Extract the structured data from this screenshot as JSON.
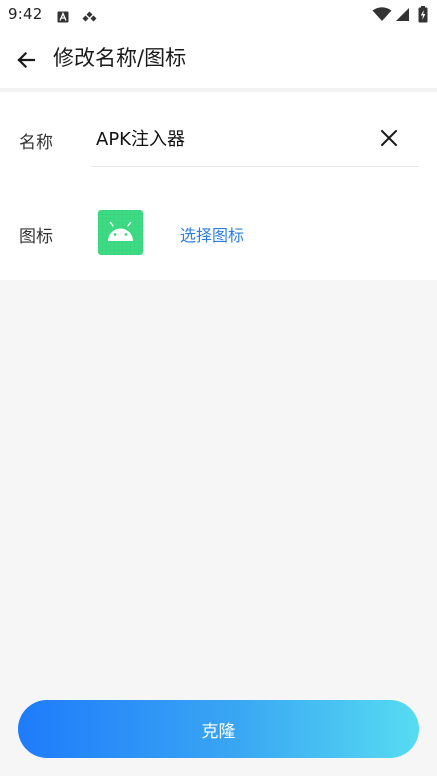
{
  "status_bar": {
    "time": "9:42",
    "icons": [
      "a-notification-icon",
      "diamond-app-icon",
      "wifi-icon",
      "cell-signal-icon",
      "battery-charging-icon"
    ]
  },
  "app_bar": {
    "title": "修改名称/图标",
    "back_icon": "arrow-back-icon"
  },
  "form": {
    "name_label": "名称",
    "name_value": "APK注入器",
    "clear_icon": "close-icon",
    "icon_label": "图标",
    "app_icon": "android-icon",
    "choose_icon_text": "选择图标"
  },
  "actions": {
    "clone_label": "克隆"
  },
  "colors": {
    "accent_link": "#2f7fe0",
    "button_gradient_start": "#1e7bfb",
    "button_gradient_end": "#56dcf2",
    "android_icon_green": "#3ddc84",
    "page_background": "#f6f6f6"
  }
}
